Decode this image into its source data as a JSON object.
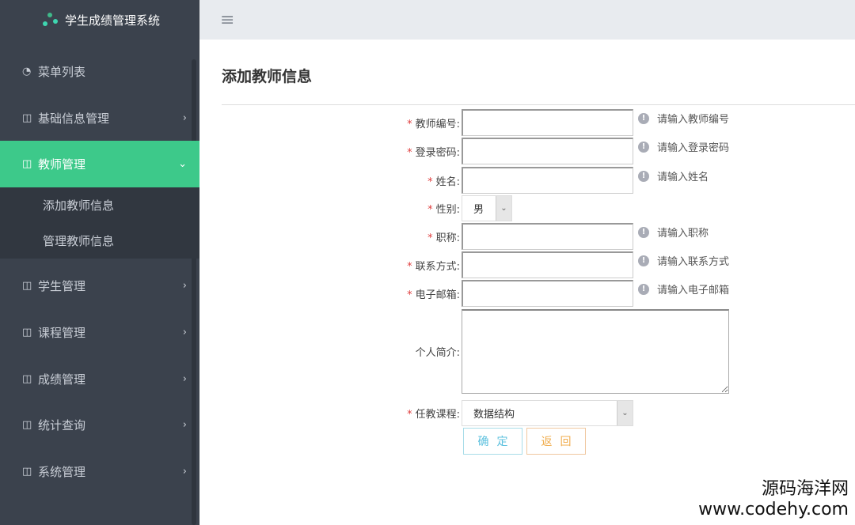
{
  "app": {
    "title": "学生成绩管理系统"
  },
  "sidebar": {
    "items": [
      {
        "label": "菜单列表",
        "icon": "dashboard-icon"
      },
      {
        "label": "基础信息管理",
        "icon": "table-icon"
      },
      {
        "label": "教师管理",
        "icon": "table-icon",
        "active": true,
        "children": [
          "添加教师信息",
          "管理教师信息"
        ]
      },
      {
        "label": "学生管理",
        "icon": "table-icon"
      },
      {
        "label": "课程管理",
        "icon": "table-icon"
      },
      {
        "label": "成绩管理",
        "icon": "table-icon"
      },
      {
        "label": "统计查询",
        "icon": "table-icon"
      },
      {
        "label": "系统管理",
        "icon": "table-icon"
      }
    ]
  },
  "page": {
    "title": "添加教师信息"
  },
  "form": {
    "fields": [
      {
        "label": "教师编号:",
        "hint": "请输入教师编号",
        "value": ""
      },
      {
        "label": "登录密码:",
        "hint": "请输入登录密码",
        "value": ""
      },
      {
        "label": "姓名:",
        "hint": "请输入姓名",
        "value": ""
      },
      {
        "label": "性别:",
        "value": "男"
      },
      {
        "label": "职称:",
        "hint": "请输入职称",
        "value": ""
      },
      {
        "label": "联系方式:",
        "hint": "请输入联系方式",
        "value": ""
      },
      {
        "label": "电子邮箱:",
        "hint": "请输入电子邮箱",
        "value": ""
      },
      {
        "label": "个人简介:",
        "value": ""
      },
      {
        "label": "任教课程:",
        "value": "数据结构"
      }
    ],
    "required_mark": "*",
    "confirm": "确定",
    "back": "返回"
  },
  "watermark": {
    "line1": "源码海洋网",
    "line2": "www.codehy.com"
  },
  "colors": {
    "sidebar": "#3b424d",
    "active": "#3dc98a",
    "confirm": "#5bc0de",
    "back": "#f0ad4e"
  }
}
